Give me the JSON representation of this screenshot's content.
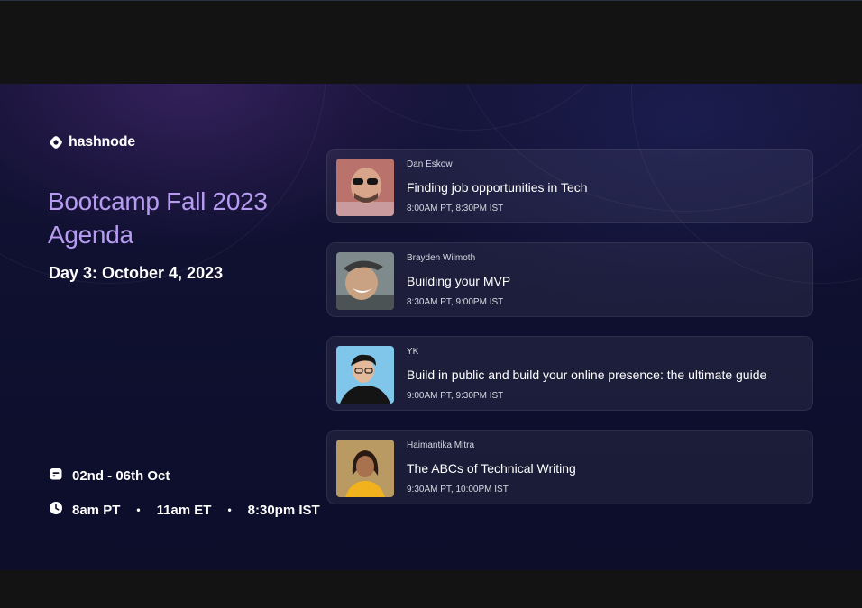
{
  "brand": {
    "name": "hashnode",
    "icon": "hashnode-logo-icon"
  },
  "event": {
    "title_line1": "Bootcamp Fall 2023",
    "title_line2": "Agenda",
    "day": "Day 3: October 4, 2023",
    "dates": "02nd - 06th Oct",
    "dates_icon": "calendar-icon",
    "times": [
      "8am PT",
      "11am ET",
      "8:30pm IST"
    ],
    "times_icon": "clock-icon"
  },
  "sessions": [
    {
      "speaker": "Dan Eskow",
      "talk": "Finding job opportunities in Tech",
      "time": "8:00AM PT, 8:30PM IST"
    },
    {
      "speaker": "Brayden Wilmoth",
      "talk": "Building your MVP",
      "time": "8:30AM PT, 9:00PM IST"
    },
    {
      "speaker": "YK",
      "talk": "Build in public and build your online presence: the ultimate guide",
      "time": "9:00AM PT, 9:30PM IST"
    },
    {
      "speaker": "Haimantika Mitra",
      "talk": "The ABCs of Technical Writing",
      "time": "9:30AM PT, 10:00PM IST"
    }
  ],
  "colors": {
    "accent": "#b69bf0",
    "background": "#0f1030",
    "frame": "#131313"
  }
}
